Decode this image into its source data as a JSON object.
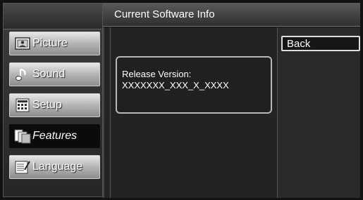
{
  "header": {
    "title": "Current Software Info"
  },
  "sidebar": {
    "items": [
      {
        "label": "Picture",
        "icon": "picture-icon",
        "selected": false
      },
      {
        "label": "Sound",
        "icon": "sound-icon",
        "selected": false
      },
      {
        "label": "Setup",
        "icon": "setup-icon",
        "selected": false
      },
      {
        "label": "Features",
        "icon": "features-icon",
        "selected": true
      },
      {
        "label": "Language",
        "icon": "language-icon",
        "selected": false
      }
    ]
  },
  "info": {
    "label": "Release Version:",
    "value": "XXXXXXX_XXX_X_XXXX"
  },
  "actions": {
    "back_label": "Back"
  }
}
